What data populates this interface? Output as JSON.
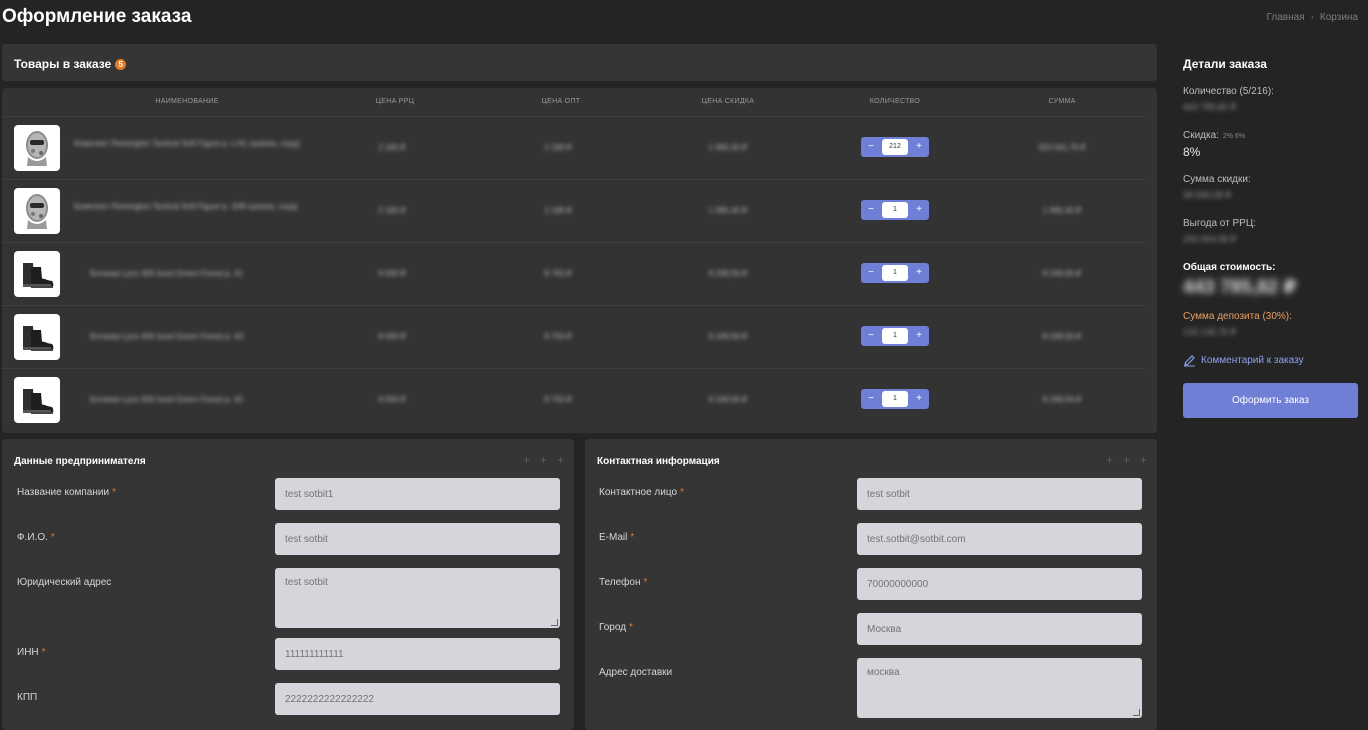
{
  "header": {
    "title": "Оформление заказа",
    "breadcrumb": [
      "Главная",
      "Корзина"
    ]
  },
  "cart": {
    "title": "Товары в заказе",
    "count": "5",
    "columns": [
      "НАИМЕНОВАНИЕ",
      "ЦЕНА РРЦ",
      "ЦЕНА ОПТ",
      "ЦЕНА СКИДКА",
      "КОЛИЧЕСТВО",
      "СУММА"
    ],
    "items": [
      {
        "name": "Комплект Remington Tactical Soft Figure р. L/XL (шапка, снуд)",
        "rrp": "2 160 ₽",
        "opt": "2 168 ₽",
        "discount": "1 995,40 ₽",
        "qty": "212",
        "sum": "423 041,76 ₽",
        "thumb": "balaclava"
      },
      {
        "name": "Комплект Remington Tactical Soft Figure р. S/M (шапка, снуд)",
        "rrp": "2 160 ₽",
        "opt": "2 168 ₽",
        "discount": "1 995,40 ₽",
        "qty": "1",
        "sum": "1 995,40 ₽",
        "thumb": "balaclava"
      },
      {
        "name": "Ботинки Lynx 400 Isool Green Forest р. 41",
        "rrp": "9 000 ₽",
        "opt": "8 763 ₽",
        "discount": "8 249,56 ₽",
        "qty": "1",
        "sum": "8 249,56 ₽",
        "thumb": "boots"
      },
      {
        "name": "Ботинки Lynx 400 Isool Green Forest р. 43",
        "rrp": "9 000 ₽",
        "opt": "8 763 ₽",
        "discount": "8 249,56 ₽",
        "qty": "1",
        "sum": "8 249,56 ₽",
        "thumb": "boots"
      },
      {
        "name": "Ботинки Lynx 400 Isool Green Forest р. 42",
        "rrp": "9 000 ₽",
        "opt": "8 763 ₽",
        "discount": "8 249,56 ₽",
        "qty": "1",
        "sum": "8 249,56 ₽",
        "thumb": "boots"
      }
    ]
  },
  "entrepreneur": {
    "title": "Данные предпринимателя",
    "fields": [
      {
        "label": "Название компании",
        "value": "test sotbit1",
        "required": "*"
      },
      {
        "label": "Ф.И.О.",
        "value": "test sotbit",
        "required": "*"
      },
      {
        "label": "Юридический адрес",
        "value": "test sotbit",
        "required": ""
      },
      {
        "label": "ИНН",
        "value": "111111111111",
        "required": "*"
      },
      {
        "label": "КПП",
        "value": "2222222222222222",
        "required": ""
      }
    ]
  },
  "contact": {
    "title": "Контактная информация",
    "fields": [
      {
        "label": "Контактное лицо",
        "value": "test sotbit",
        "required": "*"
      },
      {
        "label": "E-Mail",
        "value": "test.sotbit@sotbit.com",
        "required": "*"
      },
      {
        "label": "Телефон",
        "value": "70000000000",
        "required": "*"
      },
      {
        "label": "Город",
        "value": "Москва",
        "required": "*"
      },
      {
        "label": "Адрес доставки",
        "value": "москва",
        "required": ""
      }
    ]
  },
  "summary": {
    "title": "Детали заказа",
    "quantity_label": "Количество (5/216):",
    "quantity_value": "443 785,82 ₽",
    "discount_label": "Скидка:",
    "discount_tiers": "2%  6%",
    "discount_value": "8%",
    "discount_sum_label": "Сумма скидки:",
    "discount_sum_value": "38 590,08 ₽",
    "savings_label": "Выгода от РРЦ:",
    "savings_value": "293 654,08 ₽",
    "total_label": "Общая стоимость:",
    "total_value": "443 785,82 ₽",
    "deposit_label": "Сумма депозита (30%):",
    "deposit_value": "133 135,75 ₽",
    "comment_link": "Комментарий к заказу",
    "submit_label": "Оформить заказ"
  },
  "colors": {
    "accent": "#6f7fd6",
    "badge": "#e07b2c",
    "deposit": "#e8a060"
  }
}
